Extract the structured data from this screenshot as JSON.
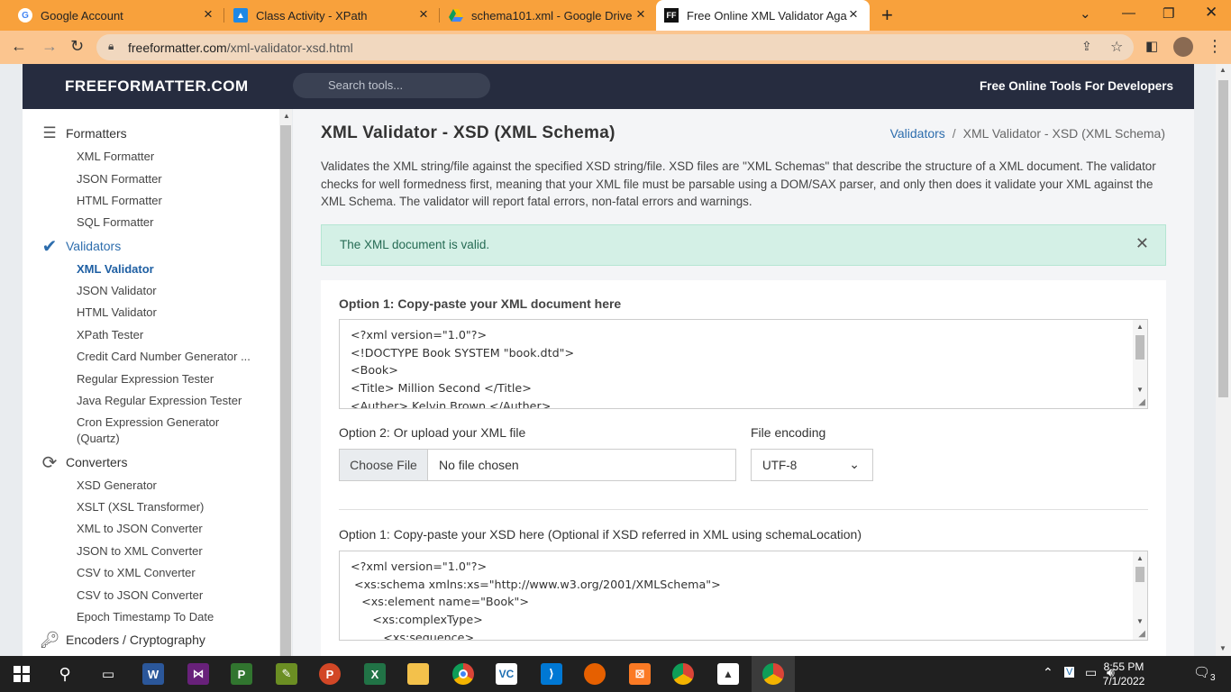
{
  "browser": {
    "tabs": [
      {
        "title": "Google Account",
        "icon": "google-icon",
        "active": false
      },
      {
        "title": "Class Activity - XPath",
        "icon": "google-classroom-icon",
        "active": false
      },
      {
        "title": "schema101.xml - Google Drive",
        "icon": "google-drive-icon",
        "active": false
      },
      {
        "title": "Free Online XML Validator Agains",
        "icon": "freeformatter-icon",
        "active": true
      }
    ],
    "url_host": "freeformatter.com",
    "url_path": "/xml-validator-xsd.html"
  },
  "site": {
    "logo": "FREEFORMATTER.COM",
    "search_placeholder": "Search tools...",
    "tagline": "Free Online Tools For Developers"
  },
  "sidebar": {
    "sections": [
      {
        "label": "Formatters",
        "icon": "list-icon",
        "active": false,
        "items": [
          "XML Formatter",
          "JSON Formatter",
          "HTML Formatter",
          "SQL Formatter"
        ]
      },
      {
        "label": "Validators",
        "icon": "checkmark-icon",
        "active": true,
        "items": [
          "XML Validator",
          "JSON Validator",
          "HTML Validator",
          "XPath Tester",
          "Credit Card Number Generator ...",
          "Regular Expression Tester",
          "Java Regular Expression Tester",
          "Cron Expression Generator (Quartz)"
        ]
      },
      {
        "label": "Converters",
        "icon": "refresh-icon",
        "active": false,
        "items": [
          "XSD Generator",
          "XSLT (XSL Transformer)",
          "XML to JSON Converter",
          "JSON to XML Converter",
          "CSV to XML Converter",
          "CSV to JSON Converter",
          "Epoch Timestamp To Date"
        ]
      },
      {
        "label": "Encoders / Cryptography",
        "icon": "key-icon",
        "active": false,
        "items": []
      }
    ],
    "active_item": "XML Validator"
  },
  "main": {
    "title": "XML Validator - XSD (XML Schema)",
    "breadcrumb_link": "Validators",
    "breadcrumb_current": "XML Validator - XSD (XML Schema)",
    "description": "Validates the XML string/file against the specified XSD string/file. XSD files are \"XML Schemas\" that describe the structure of a XML document. The validator checks for well formedness first, meaning that your XML file must be parsable using a DOM/SAX parser, and only then does it validate your XML against the XML Schema. The validator will report fatal errors, non-fatal errors and warnings.",
    "alert": "The XML document is valid.",
    "xml_label": "Option 1: Copy-paste your XML document here",
    "xml_value": "<?xml version=\"1.0\"?>\n<!DOCTYPE Book SYSTEM \"book.dtd\">\n<Book>\n<Title> Million Second </Title>\n<Auther> Kelvin Brown </Auther>",
    "upload_label": "Option 2: Or upload your XML file",
    "choose_file": "Choose File",
    "file_status": "No file chosen",
    "encoding_label": "File encoding",
    "encoding_value": "UTF-8",
    "xsd_label": "Option 1: Copy-paste your XSD here (Optional if XSD referred in XML using schemaLocation)",
    "xsd_value": "<?xml version=\"1.0\"?>\n <xs:schema xmlns:xs=\"http://www.w3.org/2001/XMLSchema\">\n   <xs:element name=\"Book\">\n      <xs:complexType>\n         <xs:sequence>"
  },
  "taskbar": {
    "apps": [
      "start-icon",
      "search-icon",
      "task-view-icon",
      "word-icon",
      "visual-studio-icon",
      "project-icon",
      "visio-icon",
      "powerpoint-icon",
      "excel-icon",
      "file-explorer-icon",
      "chrome-icon",
      "vc-icon",
      "vscode-icon",
      "firefox-icon",
      "xampp-icon",
      "chrome-profile-icon",
      "photos-icon",
      "chrome-active-icon"
    ],
    "time": "8:55 PM",
    "date": "7/1/2022",
    "notifications": "3"
  }
}
